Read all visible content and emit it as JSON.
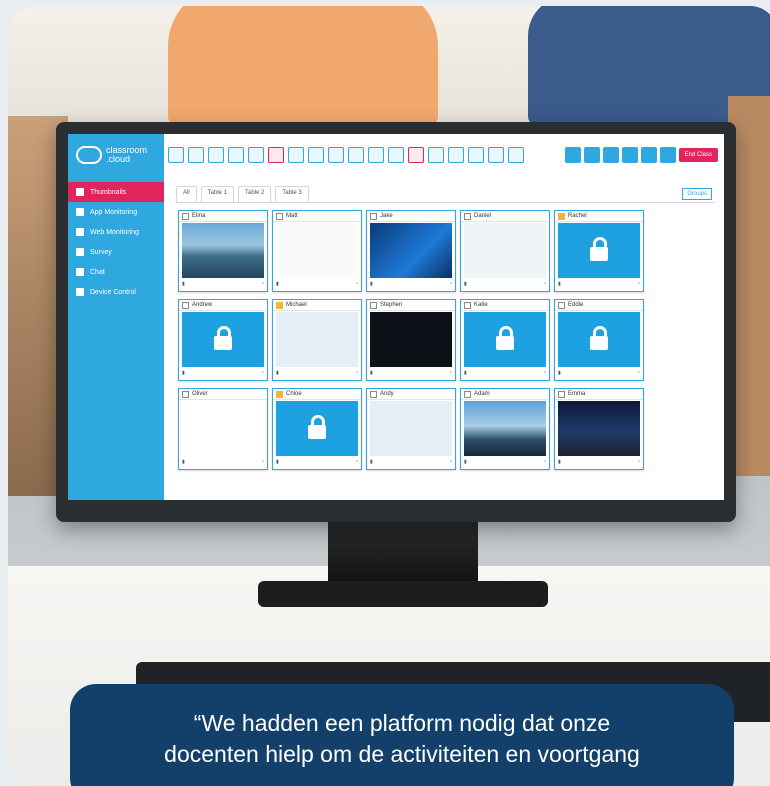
{
  "app": {
    "logo_line1": "classroom",
    "logo_line2": ".cloud",
    "nav": [
      {
        "label": "Thumbnails",
        "active": true
      },
      {
        "label": "App Monitoring",
        "active": false
      },
      {
        "label": "Web Monitoring",
        "active": false
      },
      {
        "label": "Survey",
        "active": false
      },
      {
        "label": "Chat",
        "active": false
      },
      {
        "label": "Device Control",
        "active": false
      }
    ],
    "end_class_label": "End Class",
    "tabs": [
      "All",
      "Table 1",
      "Table 2",
      "Table 3"
    ],
    "groups_label": "Groups",
    "students": [
      {
        "name": "Elina",
        "checked": false,
        "thumb": "mountain"
      },
      {
        "name": "Matt",
        "checked": false,
        "thumb": "google"
      },
      {
        "name": "Jake",
        "checked": false,
        "thumb": "windows"
      },
      {
        "name": "Daniel",
        "checked": false,
        "thumb": "dialog"
      },
      {
        "name": "Rachel",
        "checked": true,
        "thumb": "lock"
      },
      {
        "name": "Andrew",
        "checked": false,
        "thumb": "lock"
      },
      {
        "name": "Michael",
        "checked": true,
        "thumb": "screen"
      },
      {
        "name": "Stephen",
        "checked": false,
        "thumb": "dark"
      },
      {
        "name": "Katie",
        "checked": false,
        "thumb": "lock"
      },
      {
        "name": "Eddie",
        "checked": false,
        "thumb": "lock"
      },
      {
        "name": "Oliver",
        "checked": false,
        "thumb": "chart"
      },
      {
        "name": "Chloe",
        "checked": true,
        "thumb": "lock"
      },
      {
        "name": "Andy",
        "checked": false,
        "thumb": "screen"
      },
      {
        "name": "Adam",
        "checked": false,
        "thumb": "lake"
      },
      {
        "name": "Emma",
        "checked": false,
        "thumb": "night"
      }
    ]
  },
  "quote": {
    "line1": "“We hadden een platform nodig dat onze",
    "line2": "docenten hielp om de activiteiten en voortgang"
  },
  "colors": {
    "accent": "#2fa8e0",
    "danger": "#e0245e",
    "quote_bg": "#12406b"
  }
}
